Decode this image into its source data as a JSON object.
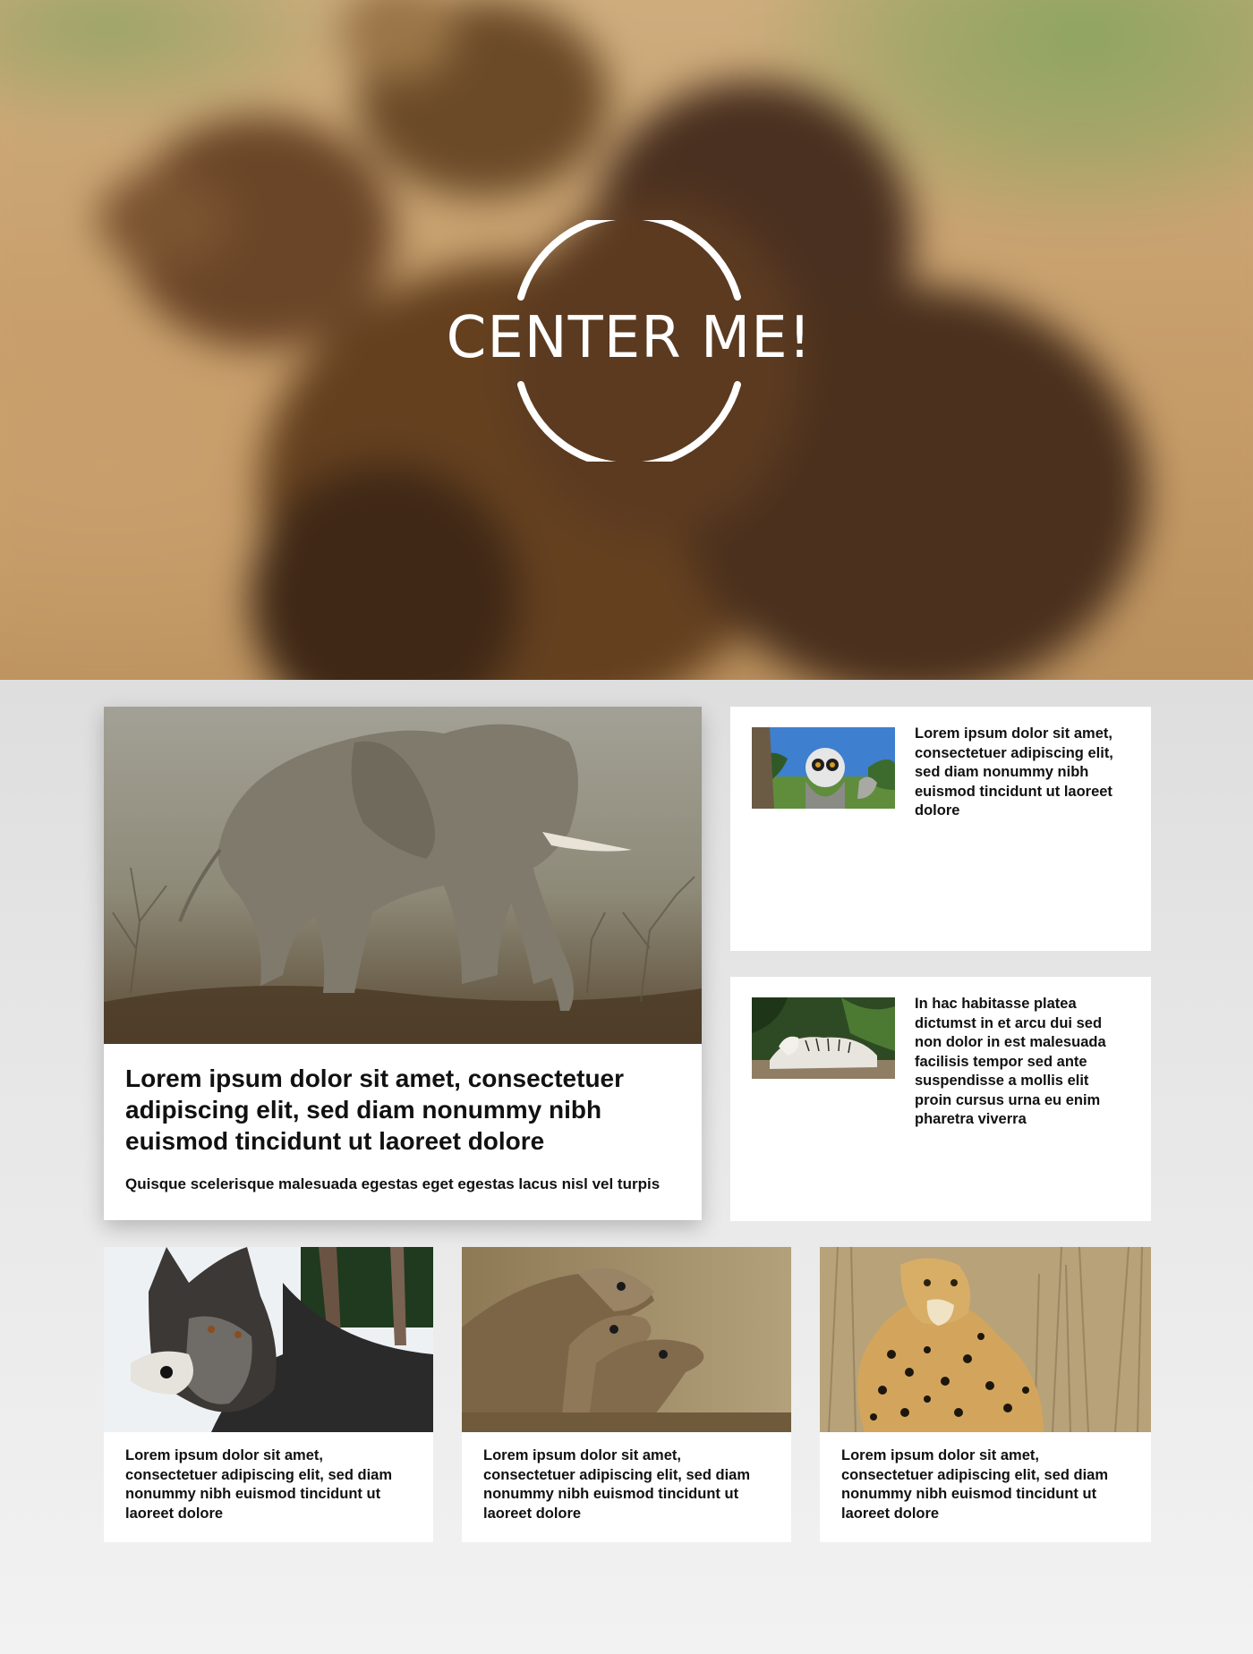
{
  "hero": {
    "logo_text": "CENTER ME!"
  },
  "featured": {
    "image": "elephant-photo",
    "title": "Lorem ipsum dolor sit amet, consectetuer adipiscing elit, sed diam nonummy nibh euismod tincidunt ut laoreet dolore",
    "subtitle": "Quisque scelerisque malesuada egestas eget egestas lacus nisl vel turpis"
  },
  "side_cards": [
    {
      "image": "lemur-photo",
      "text": "Lorem ipsum dolor sit amet, consectetuer adipiscing elit, sed diam nonummy nibh euismod tincidunt ut laoreet dolore"
    },
    {
      "image": "white-tiger-photo",
      "text": "In hac habitasse platea dictumst in et arcu dui sed non dolor in est malesuada facilisis tempor sed ante suspendisse a mollis elit proin cursus urna eu enim pharetra viverra"
    }
  ],
  "bottom_cards": [
    {
      "image": "wolf-photo",
      "text": "Lorem ipsum dolor sit amet, consectetuer adipiscing elit, sed diam nonummy nibh euismod tincidunt ut laoreet dolore"
    },
    {
      "image": "meerkats-photo",
      "text": "Lorem ipsum dolor sit amet, consectetuer adipiscing elit, sed diam nonummy nibh euismod tincidunt ut laoreet dolore"
    },
    {
      "image": "cheetah-photo",
      "text": "Lorem ipsum dolor sit amet, consectetuer adipiscing elit, sed diam nonummy nibh euismod tincidunt ut laoreet dolore"
    }
  ]
}
